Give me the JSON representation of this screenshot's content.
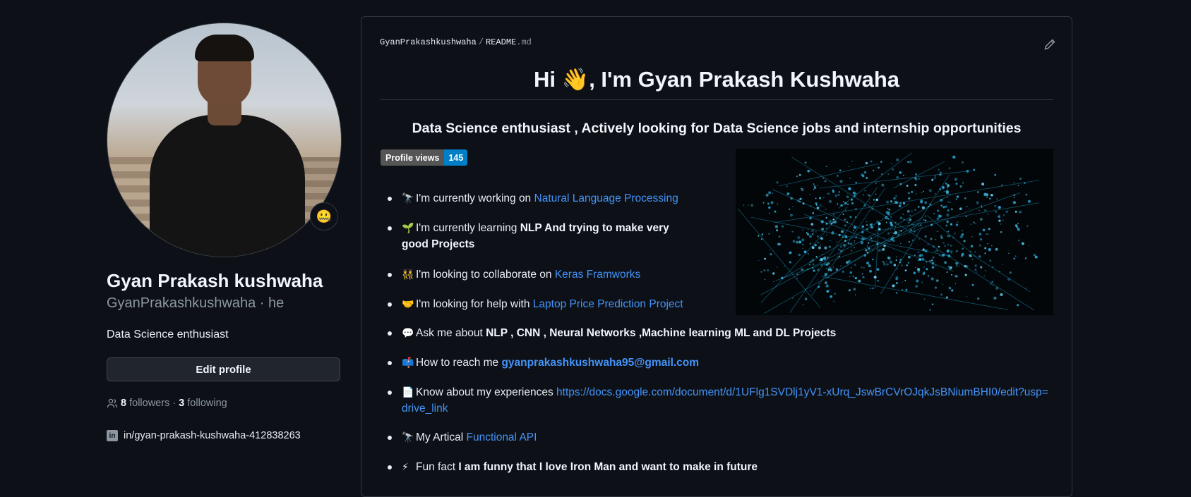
{
  "profile": {
    "name": "Gyan Prakash kushwaha",
    "username_line": "GyanPrakashkushwaha · he",
    "bio": "Data Science enthusiast",
    "status_emoji": "🤐",
    "edit_button": "Edit profile",
    "followers_count": "8",
    "followers_label": "followers",
    "separator": "·",
    "following_count": "3",
    "following_label": "following",
    "linkedin": "in/gyan-prakash-kushwaha-412838263"
  },
  "readme": {
    "crumb_user": "GyanPrakashkushwaha",
    "crumb_sep": "/",
    "crumb_file": "README",
    "crumb_ext": ".md",
    "title": "Hi 👋, I'm Gyan Prakash Kushwaha",
    "subtitle": "Data Science enthusiast , Actively looking for Data Science jobs and internship opportunities",
    "badge_label": "Profile views",
    "badge_value": "145",
    "items": [
      {
        "emoji": "🔭",
        "text": "I'm currently working on ",
        "link": "Natural Language Processing"
      },
      {
        "emoji": "🌱",
        "text": "I'm currently learning ",
        "bold": "NLP And trying to make very good Projects"
      },
      {
        "emoji": "👯",
        "text": "I'm looking to collaborate on ",
        "link": "Keras Framworks"
      },
      {
        "emoji": "🤝",
        "text": "I'm looking for help with ",
        "link": "Laptop Price Prediction Project"
      },
      {
        "emoji": "💬",
        "text": "Ask me about ",
        "bold": "NLP , CNN , Neural Networks ,Machine learning ML and DL Projects"
      },
      {
        "emoji": "📫",
        "text": "How to reach me ",
        "bold_link": "gyanprakashkushwaha95@gmail.com"
      },
      {
        "emoji": "📄",
        "text": "Know about my experiences ",
        "link": "https://docs.google.com/document/d/1UFlg1SVDlj1yV1-xUrq_JswBrCVrOJqkJsBNiumBHI0/edit?usp=drive_link"
      },
      {
        "emoji": "🔭",
        "text": "My Artical ",
        "link": "Functional API"
      },
      {
        "emoji": "⚡",
        "text": "Fun fact ",
        "bold": "I am funny that I love Iron Man and want to make in future"
      }
    ]
  },
  "colors": {
    "background": "#0d1117",
    "link": "#4493f8",
    "badge_value_bg": "#007ec6"
  }
}
